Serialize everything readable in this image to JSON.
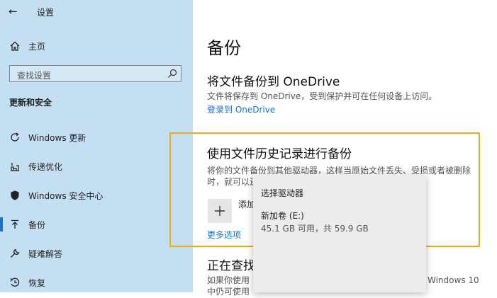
{
  "window": {
    "title": "设置",
    "back_label": "←"
  },
  "sidebar": {
    "home_label": "主页",
    "search_placeholder": "查找设置",
    "section_title": "更新和安全",
    "items": [
      {
        "label": "Windows 更新",
        "icon": "refresh-icon"
      },
      {
        "label": "传递优化",
        "icon": "delivery-optimization-icon"
      },
      {
        "label": "Windows 安全中心",
        "icon": "shield-icon"
      },
      {
        "label": "备份",
        "icon": "backup-arrow-icon",
        "selected": true
      },
      {
        "label": "疑难解答",
        "icon": "wrench-icon"
      },
      {
        "label": "恢复",
        "icon": "recovery-icon"
      }
    ]
  },
  "main": {
    "title": "备份",
    "onedrive": {
      "heading": "将文件备份到 OneDrive",
      "desc": "文件将保存到 OneDrive，受到保护并可在任何设备上访问。",
      "link": "登录到 OneDrive"
    },
    "history": {
      "heading": "使用文件历史记录进行备份",
      "desc_line1": "将你的文件备份到其他驱动器，这样当原始文件丢失、受损或者被删除",
      "desc_line2": "时，就可以还",
      "add_label": "添加",
      "more_link": "更多选项"
    },
    "older": {
      "heading": "正在查找",
      "desc_start": "如果你使用",
      "desc_line2": "中仍可使用",
      "desc_tail": "Windows 10"
    }
  },
  "flyout": {
    "title": "选择驱动器",
    "drive_name": "新加卷 (E:)",
    "drive_space": "45.1 GB 可用，共 59.9 GB"
  },
  "colors": {
    "sidebar_bg": "#c4dff1",
    "accent": "#1a6fc2",
    "focus_border": "#f0ad16"
  }
}
